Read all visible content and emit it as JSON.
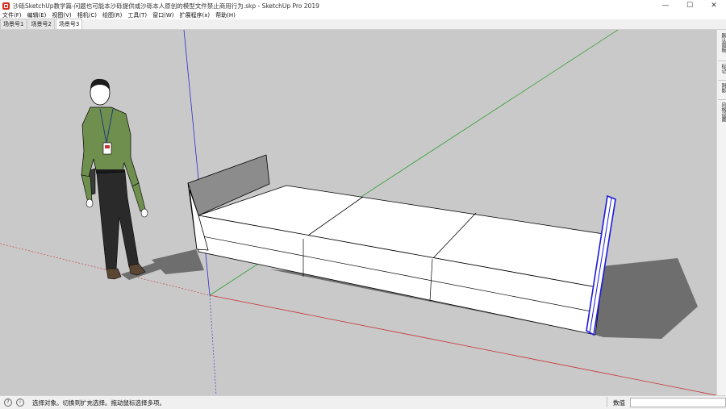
{
  "window": {
    "title": "沙砾SketchUp教学篇-问题也可能本沙砾提供或沙砾本人原创的模型文件禁止商用行为.skp - SketchUp Pro 2019",
    "minimize_label": "—",
    "maximize_label": "☐",
    "close_label": "✕"
  },
  "menu": {
    "items": [
      {
        "label": "文件(F)"
      },
      {
        "label": "编辑(E)"
      },
      {
        "label": "视图(V)"
      },
      {
        "label": "相机(C)"
      },
      {
        "label": "绘图(R)"
      },
      {
        "label": "工具(T)"
      },
      {
        "label": "窗口(W)"
      },
      {
        "label": "扩展程序(x)"
      },
      {
        "label": "帮助(H)"
      }
    ]
  },
  "scene_tabs": [
    {
      "label": "场景号1",
      "active": false
    },
    {
      "label": "场景号2",
      "active": false
    },
    {
      "label": "场景号3",
      "active": true
    }
  ],
  "right_panel": {
    "items": [
      {
        "label": "默认面板"
      },
      {
        "label": "标记"
      },
      {
        "label": "阴影"
      },
      {
        "label": "风格设置"
      }
    ]
  },
  "status": {
    "message": "选择对象。切换到扩充选择。拖动鼠标选择多项。",
    "measure_label": "数值",
    "measure_value": "",
    "icon1": "?",
    "icon2": "i"
  },
  "colors": {
    "viewport_bg": "#c9c9c9",
    "axis_red": "#c83232",
    "axis_green": "#2e9e2e",
    "axis_blue": "#2d2dc8",
    "selection": "#1a1adc",
    "shirt": "#6f8f4e",
    "pants": "#2a2a2a",
    "shadow": "#6e6e6e"
  }
}
